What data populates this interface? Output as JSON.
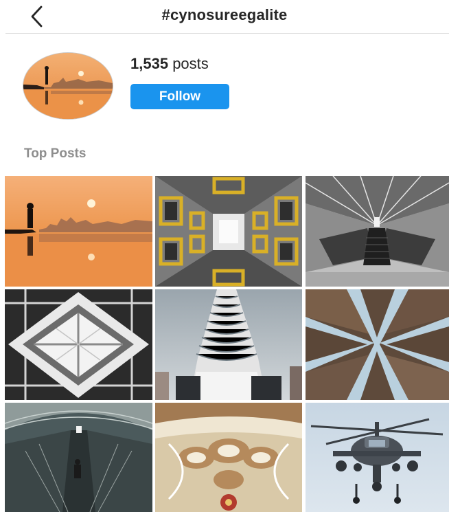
{
  "header": {
    "back_icon": "chevron-left-icon",
    "title": "#cynosureegalite"
  },
  "profile": {
    "posts_count": "1,535",
    "posts_label": "posts",
    "follow_label": "Follow",
    "accent_color": "#1a94ee"
  },
  "top_posts": {
    "title": "Top Posts",
    "items": [
      {
        "subject": "sunset silhouette reflection"
      },
      {
        "subject": "courtyard looking up yellow windows"
      },
      {
        "subject": "escalator tunnel black and white"
      },
      {
        "subject": "skylight geometry black and white"
      },
      {
        "subject": "curved skyscraper"
      },
      {
        "subject": "narrow streets looking up"
      },
      {
        "subject": "metro escalator tunnel"
      },
      {
        "subject": "baroque church ceiling"
      },
      {
        "subject": "attack helicopter"
      }
    ]
  }
}
